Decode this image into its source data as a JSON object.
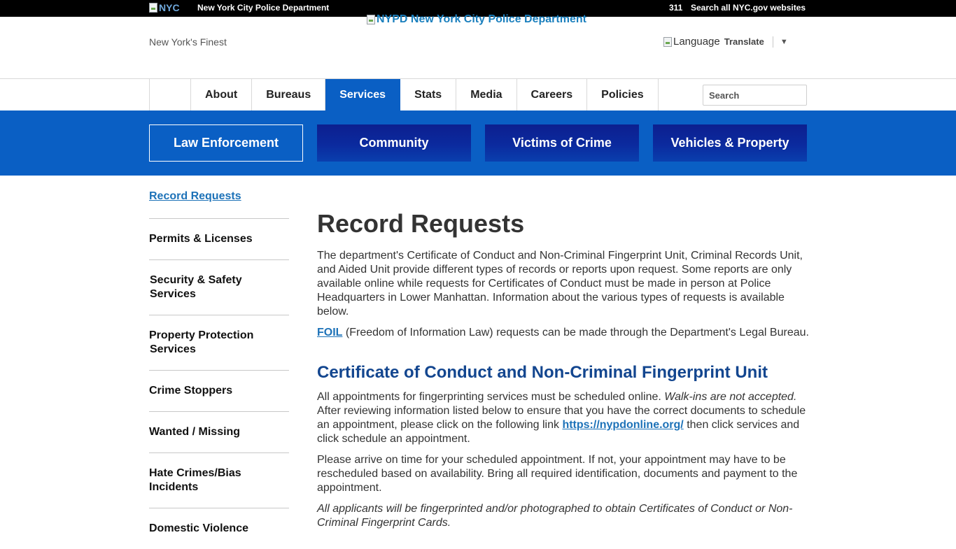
{
  "topbar": {
    "nyc_logo_alt": "NYC",
    "agency": "New York City Police Department",
    "link_311": "311",
    "search_all": "Search all NYC.gov websites"
  },
  "header": {
    "logo_alt": "NYPD New York City Police Department",
    "tagline": "New York's Finest",
    "language_alt": "Language",
    "translate_label": "Translate",
    "translate_arrow": "▼"
  },
  "nav": {
    "items": [
      {
        "label": "About",
        "active": false
      },
      {
        "label": "Bureaus",
        "active": false
      },
      {
        "label": "Services",
        "active": true
      },
      {
        "label": "Stats",
        "active": false
      },
      {
        "label": "Media",
        "active": false
      },
      {
        "label": "Careers",
        "active": false
      },
      {
        "label": "Policies",
        "active": false
      }
    ],
    "search_placeholder": "Search"
  },
  "subnav": {
    "tiles": [
      {
        "label": "Law Enforcement",
        "active": true
      },
      {
        "label": "Community",
        "active": false
      },
      {
        "label": "Victims of Crime",
        "active": false
      },
      {
        "label": "Vehicles & Property",
        "active": false
      }
    ]
  },
  "sidebar": {
    "current": "Record Requests",
    "items": [
      {
        "line1": "Permits & Licenses",
        "line2": ""
      },
      {
        "line1": "Security & Safety",
        "line2": "Services"
      },
      {
        "line1": "Property Protection",
        "line2": "Services"
      },
      {
        "line1": "Crime Stoppers",
        "line2": ""
      },
      {
        "line1": "Wanted / Missing",
        "line2": ""
      },
      {
        "line1": "Hate Crimes/Bias",
        "line2": "Incidents"
      },
      {
        "line1": "Domestic Violence",
        "line2": ""
      }
    ]
  },
  "main": {
    "title": "Record Requests",
    "intro": "The department's Certificate of Conduct and Non-Criminal Fingerprint Unit, Criminal Records Unit, and Aided Unit provide different types of records or reports upon request. Some reports are only available online while requests for Certificates of Conduct must be made in person at Police Headquarters in Lower Manhattan. Information about the various types of requests is available below.",
    "foil_link": "FOIL",
    "foil_text": " (Freedom of Information Law) requests can be made through the Department's Legal Bureau.",
    "section_title": "Certificate of Conduct and Non-Criminal Fingerprint Unit",
    "p1_a": "All appointments for fingerprinting services must be scheduled online. ",
    "p1_em": "Walk-ins are not accepted.",
    "p1_b": " After reviewing information listed below to ensure that you have the correct documents to schedule an appointment, please click on the following link ",
    "p1_link": "https://nypdonline.org/",
    "p1_c": " then click services and click schedule an appointment.",
    "p2": "Please arrive on time for your scheduled appointment. If not, your appointment may have to be rescheduled based on availability. Bring all required identification, documents and payment to the appointment.",
    "p3": "All applicants will be fingerprinted and/or photographed to obtain Certificates of Conduct or Non-Criminal Fingerprint Cards."
  },
  "colors": {
    "brand_blue": "#0a5fc4",
    "tile_navy": "#0c1f8f",
    "link_blue": "#1d72b8",
    "heading_blue": "#13468f"
  }
}
